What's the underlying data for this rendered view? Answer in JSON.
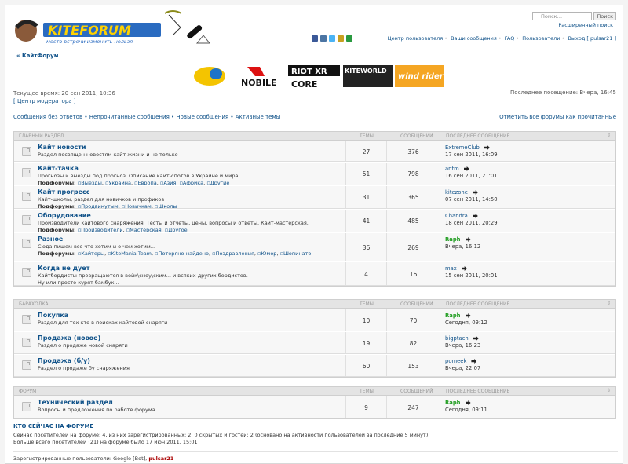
{
  "header": {
    "search_placeholder": "Поиск…",
    "search_button": "Поиск",
    "advanced_search": "Расширенный поиск",
    "nav": [
      "Центр пользователя",
      "Ваши сообщения",
      "FAQ",
      "Пользователи",
      "Выход [ pulsar21 ]"
    ]
  },
  "breadcrumb": "КайтФорум",
  "time": {
    "current": "Текущее время: 20 сен 2011, 10:36",
    "moderator_center": "[ Центр модератора ]",
    "last_visit": "Последнее посещение: Вчера, 16:45"
  },
  "quicklinks": [
    "Сообщения без ответов",
    "Непрочитанные сообщения",
    "Новые сообщения",
    "Активные темы"
  ],
  "mark_read": "Отметить все форумы как прочитанные",
  "columns": {
    "topics": "Темы",
    "posts": "Сообщений",
    "last": "Последнее сообщение"
  },
  "categories": [
    {
      "title": "Главный раздел",
      "forums": [
        {
          "title": "Кайт новости",
          "desc": "Раздел посвящен новостям кайт жизни и не только",
          "subs_label": "",
          "subs": [],
          "topics": "27",
          "posts": "376",
          "author": "ExtremeClub",
          "author_green": false,
          "date": "17 сен 2011, 16:09"
        },
        {
          "title": "Кайт-тачка",
          "desc": "Прогнозы и выезды под прогноз. Описание кайт-спотов в Украине и мира",
          "subs_label": "Подфорумы:",
          "subs": [
            "Выезды",
            "Украина",
            "Европа",
            "Азия",
            "Африка",
            "Другие"
          ],
          "topics": "51",
          "posts": "798",
          "author": "antm",
          "author_green": false,
          "date": "16 сен 2011, 21:01"
        },
        {
          "title": "Кайт прогресс",
          "desc": "Кайт-школы, раздел для новичков и профиков",
          "subs_label": "Подфорумы:",
          "subs": [
            "Продвинутым",
            "Новичкам",
            "Школы"
          ],
          "topics": "31",
          "posts": "365",
          "author": "kitezone",
          "author_green": false,
          "date": "07 сен 2011, 14:50"
        },
        {
          "title": "Оборудование",
          "desc": "Производители кайтового снаряжения. Тесты и отчеты, цены, вопросы и ответы. Кайт-мастерская.",
          "subs_label": "Подфорумы:",
          "subs": [
            "Производители",
            "Мастерская",
            "Другое"
          ],
          "topics": "41",
          "posts": "485",
          "author": "Chandra",
          "author_green": false,
          "date": "18 сен 2011, 20:29"
        },
        {
          "title": "Разное",
          "desc": "Сюда пишем все что хотим и о чем хотим...",
          "subs_label": "Подфорумы:",
          "subs": [
            "Кайтеры",
            "KiteMania Team",
            "Потеряно-найдено",
            "Поздравления",
            "Юмор",
            "Шопинато"
          ],
          "topics": "36",
          "posts": "269",
          "author": "Raph",
          "author_green": true,
          "date": "Вчера, 16:12"
        },
        {
          "title": "Когда не дует",
          "desc": "Кайтбордисты превращаются в вейк\\сноу\\ским... и всяких других бордистов.",
          "desc2": "Ну или просто курят бамбук...",
          "subs_label": "",
          "subs": [],
          "topics": "4",
          "posts": "16",
          "author": "max",
          "author_green": false,
          "date": "15 сен 2011, 20:01"
        }
      ]
    },
    {
      "title": "Барахолка",
      "forums": [
        {
          "title": "Покупка",
          "desc": "Раздел для тех кто в поисках кайтовой снаряги",
          "subs_label": "",
          "subs": [],
          "topics": "10",
          "posts": "70",
          "author": "Raph",
          "author_green": true,
          "date": "Сегодня, 09:12"
        },
        {
          "title": "Продажа (новое)",
          "desc": "Раздел о продаже новой снаряги",
          "subs_label": "",
          "subs": [],
          "topics": "19",
          "posts": "82",
          "author": "bigptach",
          "author_green": false,
          "date": "Вчера, 16:23"
        },
        {
          "title": "Продажа (б/у)",
          "desc": "Раздел о продаже бу снаряжения",
          "subs_label": "",
          "subs": [],
          "topics": "60",
          "posts": "153",
          "author": "pomeek",
          "author_green": false,
          "date": "Вчера, 22:07"
        }
      ]
    },
    {
      "title": "Форум",
      "forums": [
        {
          "title": "Технический раздел",
          "desc": "Вопросы и предложения по работе форума",
          "subs_label": "",
          "subs": [],
          "topics": "9",
          "posts": "247",
          "author": "Raph",
          "author_green": true,
          "date": "Сегодня, 09:11"
        }
      ]
    }
  ],
  "who": {
    "title": "КТО СЕЙЧАС НА ФОРУМЕ",
    "line1": "Сейчас посетителей на форуме: 4, из них зарегистрированных: 2, 0 скрытых и гостей: 2 (основано на активности пользователей за последние 5 минут)",
    "line2": "Больше всего посетителей (21) на форуме было 17 июн 2011, 15:01",
    "reg_label": "Зарегистрированные пользователи: Google [Bot],",
    "reg_user": "pulsar21"
  },
  "banner_text": {
    "logo_tagline": "место встречи изменить нельзя",
    "b1": "NOBILE",
    "b2": "RIOT XR",
    "b3": "CORE",
    "b4": "KITEWORLD",
    "b5": "wind rider"
  },
  "colors": {
    "link": "#105289",
    "online_green": "#219d21"
  }
}
